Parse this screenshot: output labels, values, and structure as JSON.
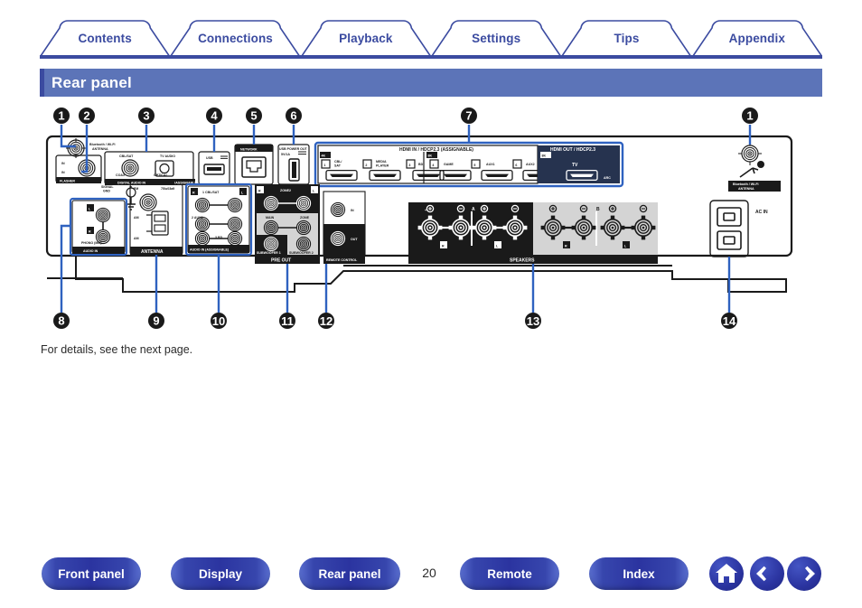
{
  "nav_tabs": [
    {
      "label": "Contents",
      "name": "tab-contents"
    },
    {
      "label": "Connections",
      "name": "tab-connections"
    },
    {
      "label": "Playback",
      "name": "tab-playback"
    },
    {
      "label": "Settings",
      "name": "tab-settings"
    },
    {
      "label": "Tips",
      "name": "tab-tips"
    },
    {
      "label": "Appendix",
      "name": "tab-appendix"
    }
  ],
  "header": {
    "title": "Rear panel"
  },
  "body": {
    "caption": "For details, see the next page."
  },
  "figure": {
    "callouts": [
      "1",
      "2",
      "3",
      "4",
      "5",
      "6",
      "7",
      "8",
      "9",
      "10",
      "11",
      "12",
      "13",
      "14"
    ],
    "labels": {
      "bt_antenna": "Bluetooth / Wi-Fi",
      "bt_antenna2": "ANTENNA",
      "flasher": "FLASHER",
      "flasher_in1": "IN",
      "flasher_in2": "IN",
      "signal_gnd1": "SIGNAL",
      "signal_gnd2": "GND",
      "digital_audio_in": "DIGITAL AUDIO IN",
      "assignable": "(ASSIGNABLE)",
      "cbl_sat": "CBL/SAT",
      "coax": "COAX",
      "tv_audio": "TV AUDIO",
      "optical": "OPTICAL",
      "usb": "USB",
      "network": "NETWORK",
      "usb_power_out": "USB POWER OUT",
      "dc_5v": "5V/1A",
      "hdmi_in_hdr": "HDMI IN / HDCP2.3  (ASSIGNABLE)",
      "hdmi_out_hdr": "HDMI OUT / HDCP2.3",
      "4k_1": "4K",
      "4k_2": "8K",
      "4k_3": "8K",
      "hdmi1_num": "1",
      "hdmi1_lbl": "CBL/ SAT",
      "hdmi2_num": "2",
      "hdmi2_lbl": "MEDIA PLAYER",
      "hdmi3_num": "3",
      "hdmi3_lbl": "BD",
      "hdmi4_num": "4",
      "hdmi4_lbl": "GAME",
      "hdmi5_num": "5",
      "hdmi5_lbl": "AUX1",
      "hdmi6_num": "6",
      "hdmi6_lbl": "AUX2",
      "hdmi_tv": "TV",
      "hdmi_arc": "ARC",
      "phono": "PHONO (MM)",
      "audio_in": "AUDIO IN",
      "ant_fm": "FM",
      "ant_75": "75Ω",
      "ant_am": "AM",
      "antenna": "ANTENNA",
      "audio_in2": "AUDIO IN (ASSIGNABLE)",
      "ai_cblsat": "1 CBL/SAT",
      "ai_aux1": "2 AUX1",
      "ai_bd": "3 BD",
      "zone2": "ZONE2",
      "pre_main": "MAIN",
      "pre_zone": "ZONE2",
      "subw1": "SUBWOOFER 1",
      "subw2": "SUBWOOFER 2",
      "pre_out": "PRE OUT",
      "remote_control": "REMOTE CONTROL",
      "rc_in": "IN",
      "rc_out": "OUT",
      "spk_A": "A",
      "spk_B": "B",
      "spk_R": "R",
      "spk_L": "L",
      "speakers": "SPEAKERS",
      "ac_in": "AC IN"
    }
  },
  "footer": {
    "buttons": [
      {
        "label": "Front panel",
        "name": "footer-front-panel"
      },
      {
        "label": "Display",
        "name": "footer-display"
      },
      {
        "label": "Rear panel",
        "name": "footer-rear-panel"
      },
      {
        "label": "Remote",
        "name": "footer-remote"
      },
      {
        "label": "Index",
        "name": "footer-index"
      }
    ],
    "page_number": "20",
    "icon_buttons": [
      {
        "icon": "home-icon",
        "name": "footer-home-button"
      },
      {
        "icon": "arrow-left-icon",
        "name": "footer-back-button"
      },
      {
        "icon": "arrow-right-icon",
        "name": "footer-forward-button"
      }
    ]
  },
  "colors": {
    "brand_blue": "#3b4ba0",
    "title_blue": "#5c74b8",
    "callout_dark": "#1a1a1a",
    "leader_blue": "#2f62c0"
  }
}
